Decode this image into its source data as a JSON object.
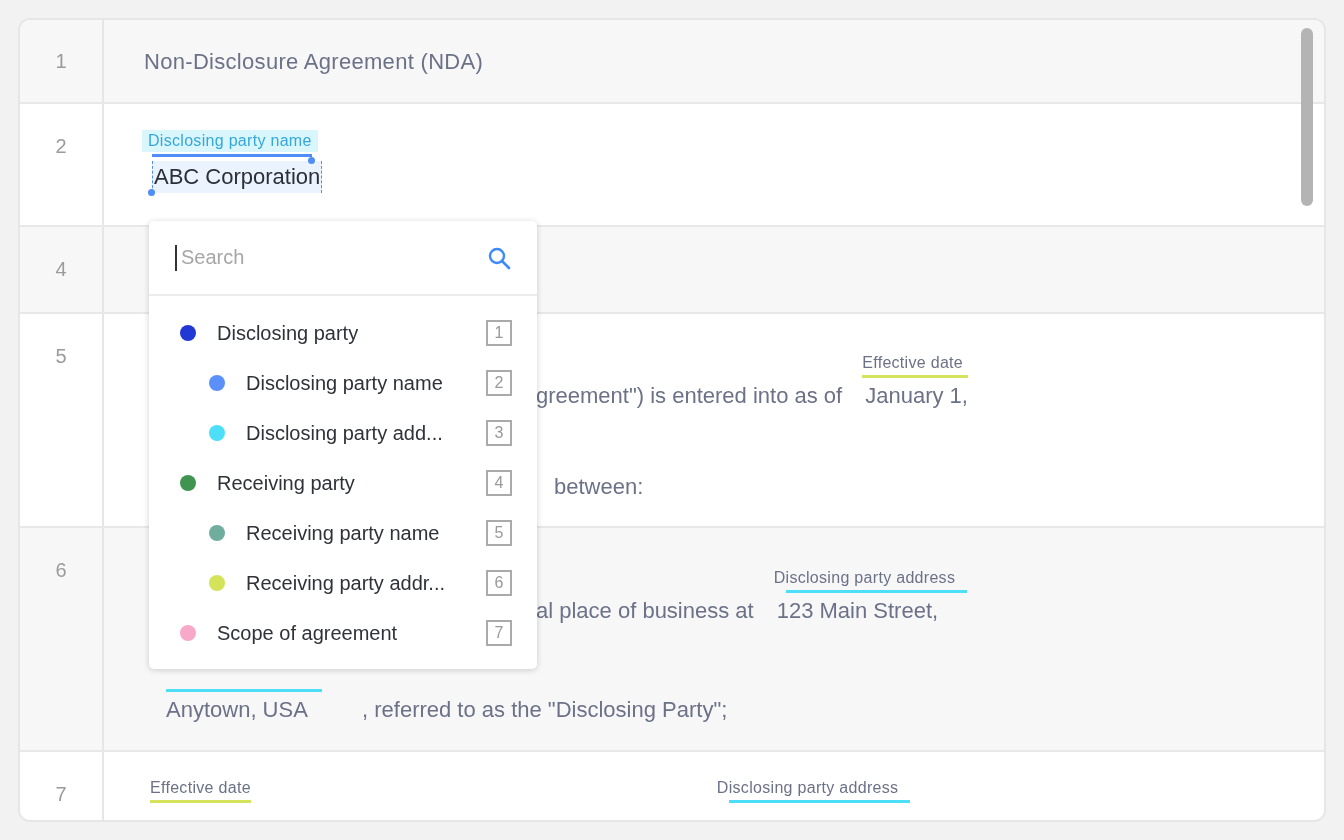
{
  "document": {
    "rows": [
      {
        "number": "1",
        "kind": "title",
        "lines": [
          [
            {
              "kind": "text",
              "text": "Non-Disclosure Agreement (NDA)"
            }
          ]
        ]
      },
      {
        "number": "2",
        "kind": "body",
        "lines": [
          [
            {
              "kind": "field",
              "label": "Disclosing party name",
              "value": "ABC Corporation",
              "color": "#4f8ef7",
              "selected": true
            }
          ]
        ]
      },
      {
        "number": "4",
        "kind": "title",
        "lines": []
      },
      {
        "number": "5",
        "kind": "body",
        "lines": [
          [
            {
              "kind": "text",
              "text": "greement\") is entered into as of"
            },
            {
              "kind": "field",
              "label": "Effective date",
              "value": "January 1,",
              "color": "#d4e35a",
              "selected": false
            }
          ],
          [
            {
              "kind": "text",
              "text": "between:"
            }
          ]
        ]
      },
      {
        "number": "6",
        "kind": "body",
        "lines": [
          [
            {
              "kind": "text",
              "text": "al place of business at"
            },
            {
              "kind": "field",
              "label": "Disclosing party address",
              "value": "123 Main Street,",
              "color": "#4ddff8",
              "selected": false
            }
          ],
          [
            {
              "kind": "field",
              "value": "Anytown, USA",
              "color": "#4ddff8",
              "selected": false
            },
            {
              "kind": "text",
              "text": ", referred to as the \"Disclosing Party\";"
            }
          ]
        ]
      },
      {
        "number": "7",
        "kind": "body",
        "lines": [
          [
            {
              "kind": "field",
              "label": "Effective date",
              "color": "#d4e35a",
              "selected": false
            },
            {
              "kind": "field",
              "label": "Disclosing party address",
              "color": "#4ddff8",
              "selected": false
            }
          ]
        ]
      }
    ]
  },
  "dropdown": {
    "search": {
      "placeholder": "Search"
    },
    "items": [
      {
        "label": "Disclosing party",
        "color": "#2238d4",
        "shortcut": "1",
        "children": [
          {
            "label": "Disclosing party name",
            "color": "#5b8ff9",
            "shortcut": "2"
          },
          {
            "label": "Disclosing party add...",
            "color": "#4ddff8",
            "shortcut": "3"
          }
        ]
      },
      {
        "label": "Receiving party",
        "color": "#3f9450",
        "shortcut": "4",
        "children": [
          {
            "label": "Receiving party name",
            "color": "#6fae9e",
            "shortcut": "5"
          },
          {
            "label": "Receiving party addr...",
            "color": "#d4e35a",
            "shortcut": "6"
          }
        ]
      },
      {
        "label": "Scope of agreement",
        "color": "#f8a8c8",
        "shortcut": "7"
      }
    ]
  }
}
